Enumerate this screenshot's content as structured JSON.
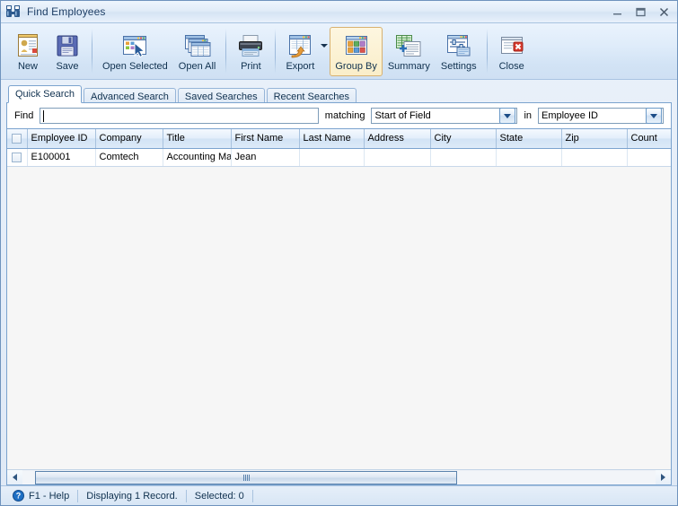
{
  "window": {
    "title": "Find Employees",
    "icon": "binoculars-icon",
    "controls": {
      "minimize": "minimize-icon",
      "maximize": "maximize-icon",
      "close": "close-icon"
    }
  },
  "toolbar": {
    "buttons": [
      {
        "label": "New",
        "icon": "new-record-icon",
        "active": false
      },
      {
        "label": "Save",
        "icon": "floppy-disk-icon",
        "active": false
      },
      {
        "label": "Open Selected",
        "icon": "open-selected-icon",
        "active": false
      },
      {
        "label": "Open All",
        "icon": "open-all-icon",
        "active": false
      },
      {
        "label": "Print",
        "icon": "printer-icon",
        "active": false
      },
      {
        "label": "Export",
        "icon": "export-icon",
        "active": false
      },
      {
        "label": "Group By",
        "icon": "group-by-icon",
        "active": true
      },
      {
        "label": "Summary",
        "icon": "summary-icon",
        "active": false
      },
      {
        "label": "Settings",
        "icon": "settings-icon",
        "active": false
      },
      {
        "label": "Close",
        "icon": "close-window-icon",
        "active": false
      }
    ],
    "export_dropdown": "chevron-down-icon"
  },
  "tabs": [
    {
      "label": "Quick Search",
      "active": true
    },
    {
      "label": "Advanced Search",
      "active": false
    },
    {
      "label": "Saved Searches",
      "active": false
    },
    {
      "label": "Recent Searches",
      "active": false
    }
  ],
  "search": {
    "find_label": "Find",
    "find_value": "",
    "find_placeholder": "",
    "matching_label": "matching",
    "matching_value": "Start of Field",
    "in_label": "in",
    "in_value": "Employee ID"
  },
  "grid": {
    "columns": [
      "Employee ID",
      "Company",
      "Title",
      "First Name",
      "Last Name",
      "Address",
      "City",
      "State",
      "Zip",
      "Count"
    ],
    "rows": [
      {
        "cells": [
          "E100001",
          "Comtech",
          "Accounting Ma",
          "Jean",
          "",
          "",
          "",
          "",
          "",
          ""
        ],
        "checked": false
      }
    ],
    "select_all_checkbox": "select-all-checkbox"
  },
  "statusbar": {
    "help": "F1 - Help",
    "help_icon": "help-icon",
    "records": "Displaying 1 Record.",
    "selected": "Selected: 0"
  },
  "colors": {
    "accent": "#7ba3ce",
    "title_text": "#1f3f66",
    "active_button_bg": "#fdf6e0",
    "active_button_border": "#d8b170"
  }
}
